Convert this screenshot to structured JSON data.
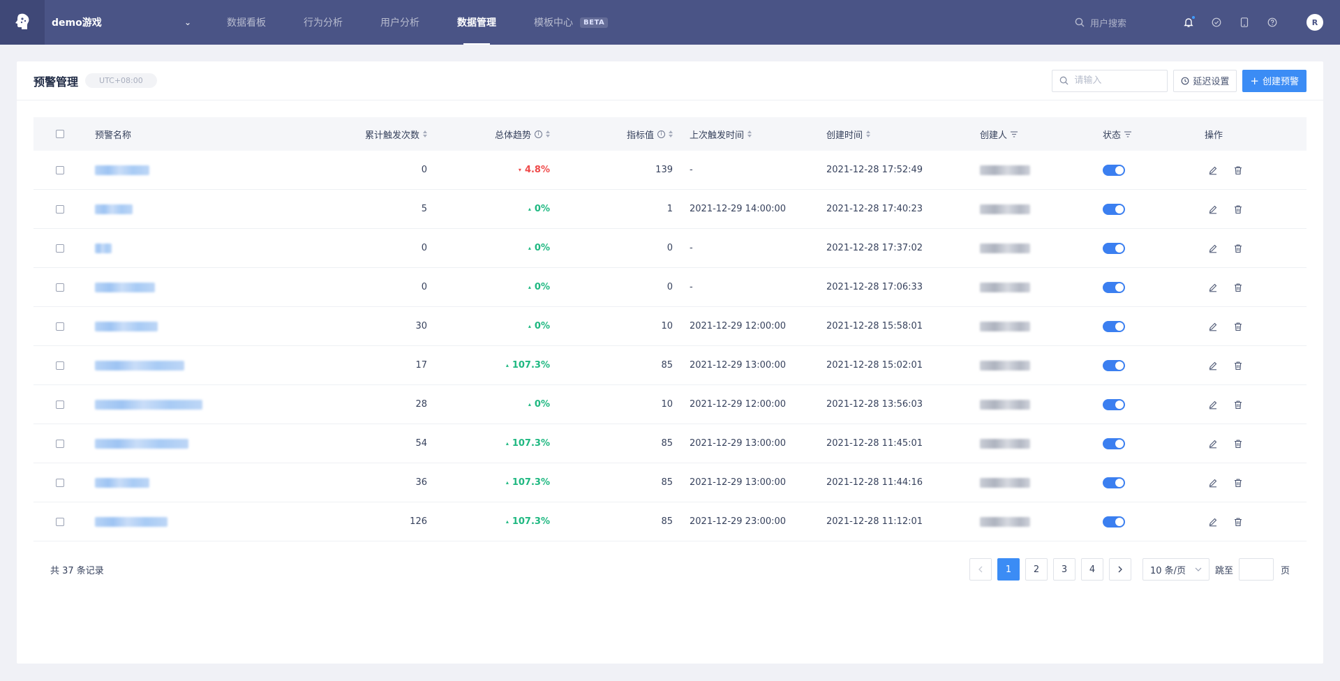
{
  "nav": {
    "project": "demo游戏",
    "tabs": [
      {
        "label": "数据看板"
      },
      {
        "label": "行为分析"
      },
      {
        "label": "用户分析"
      },
      {
        "label": "数据管理",
        "active": true
      },
      {
        "label": "模板中心",
        "badge": "BETA"
      }
    ],
    "user_search": "用户搜索",
    "avatar": "R"
  },
  "page": {
    "title": "预警管理",
    "timezone": "UTC+08:00",
    "search_placeholder": "请输入",
    "delay_button": "延迟设置",
    "create_button": "创建预警"
  },
  "table": {
    "headers": {
      "name": "预警名称",
      "count": "累计触发次数",
      "trend": "总体趋势",
      "value": "指标值",
      "last": "上次触发时间",
      "created": "创建时间",
      "creator": "创建人",
      "status": "状态",
      "ops": "操作"
    },
    "rows": [
      {
        "count": "0",
        "trend": "4.8%",
        "trend_dir": "down",
        "value": "139",
        "last": "-",
        "created": "2021-12-28 17:52:49"
      },
      {
        "count": "5",
        "trend": "0%",
        "trend_dir": "up",
        "value": "1",
        "last": "2021-12-29 14:00:00",
        "created": "2021-12-28 17:40:23"
      },
      {
        "count": "0",
        "trend": "0%",
        "trend_dir": "up",
        "value": "0",
        "last": "-",
        "created": "2021-12-28 17:37:02"
      },
      {
        "count": "0",
        "trend": "0%",
        "trend_dir": "up",
        "value": "0",
        "last": "-",
        "created": "2021-12-28 17:06:33"
      },
      {
        "count": "30",
        "trend": "0%",
        "trend_dir": "up",
        "value": "10",
        "last": "2021-12-29 12:00:00",
        "created": "2021-12-28 15:58:01"
      },
      {
        "count": "17",
        "trend": "107.3%",
        "trend_dir": "up",
        "value": "85",
        "last": "2021-12-29 13:00:00",
        "created": "2021-12-28 15:02:01"
      },
      {
        "count": "28",
        "trend": "0%",
        "trend_dir": "up",
        "value": "10",
        "last": "2021-12-29 12:00:00",
        "created": "2021-12-28 13:56:03"
      },
      {
        "count": "54",
        "trend": "107.3%",
        "trend_dir": "up",
        "value": "85",
        "last": "2021-12-29 13:00:00",
        "created": "2021-12-28 11:45:01"
      },
      {
        "count": "36",
        "trend": "107.3%",
        "trend_dir": "up",
        "value": "85",
        "last": "2021-12-29 13:00:00",
        "created": "2021-12-28 11:44:16"
      },
      {
        "count": "126",
        "trend": "107.3%",
        "trend_dir": "up",
        "value": "85",
        "last": "2021-12-29 23:00:00",
        "created": "2021-12-28 11:12:01"
      }
    ]
  },
  "pagination": {
    "total": "共 37 条记录",
    "pages": [
      "1",
      "2",
      "3",
      "4"
    ],
    "current": "1",
    "page_size": "10 条/页",
    "jump_label": "跳至",
    "page_unit": "页"
  },
  "colors": {
    "nav_bg": "#4a5486",
    "primary": "#3b8cf5",
    "trend_up": "#1fb881",
    "trend_down": "#ef4a4a"
  }
}
